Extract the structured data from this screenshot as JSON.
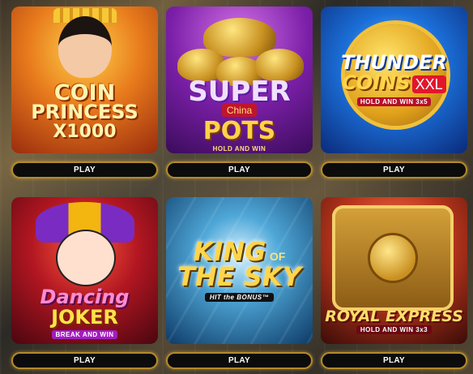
{
  "play_label": "PLAY",
  "games": [
    {
      "title_line1": "COIN",
      "title_line2": "PRINCESS",
      "title_line3": "X1000"
    },
    {
      "title_line1": "SUPER",
      "badge": "China",
      "title_line2": "POTS",
      "tagline": "HOLD AND WIN"
    },
    {
      "title_line1": "THUNDER",
      "title_line2": "COINS",
      "badge": "XXL",
      "tagline": "HOLD AND WIN 3x5"
    },
    {
      "title_line1": "Dancing",
      "title_line2": "JOKER",
      "tagline": "BREAK AND WIN"
    },
    {
      "title_line1": "KING",
      "badge": "OF",
      "title_line2": "THE SKY",
      "tagline": "HIT the BONUS™"
    },
    {
      "title_line1": "ROYAL EXPRESS",
      "tagline": "HOLD AND WIN 3x3"
    }
  ]
}
